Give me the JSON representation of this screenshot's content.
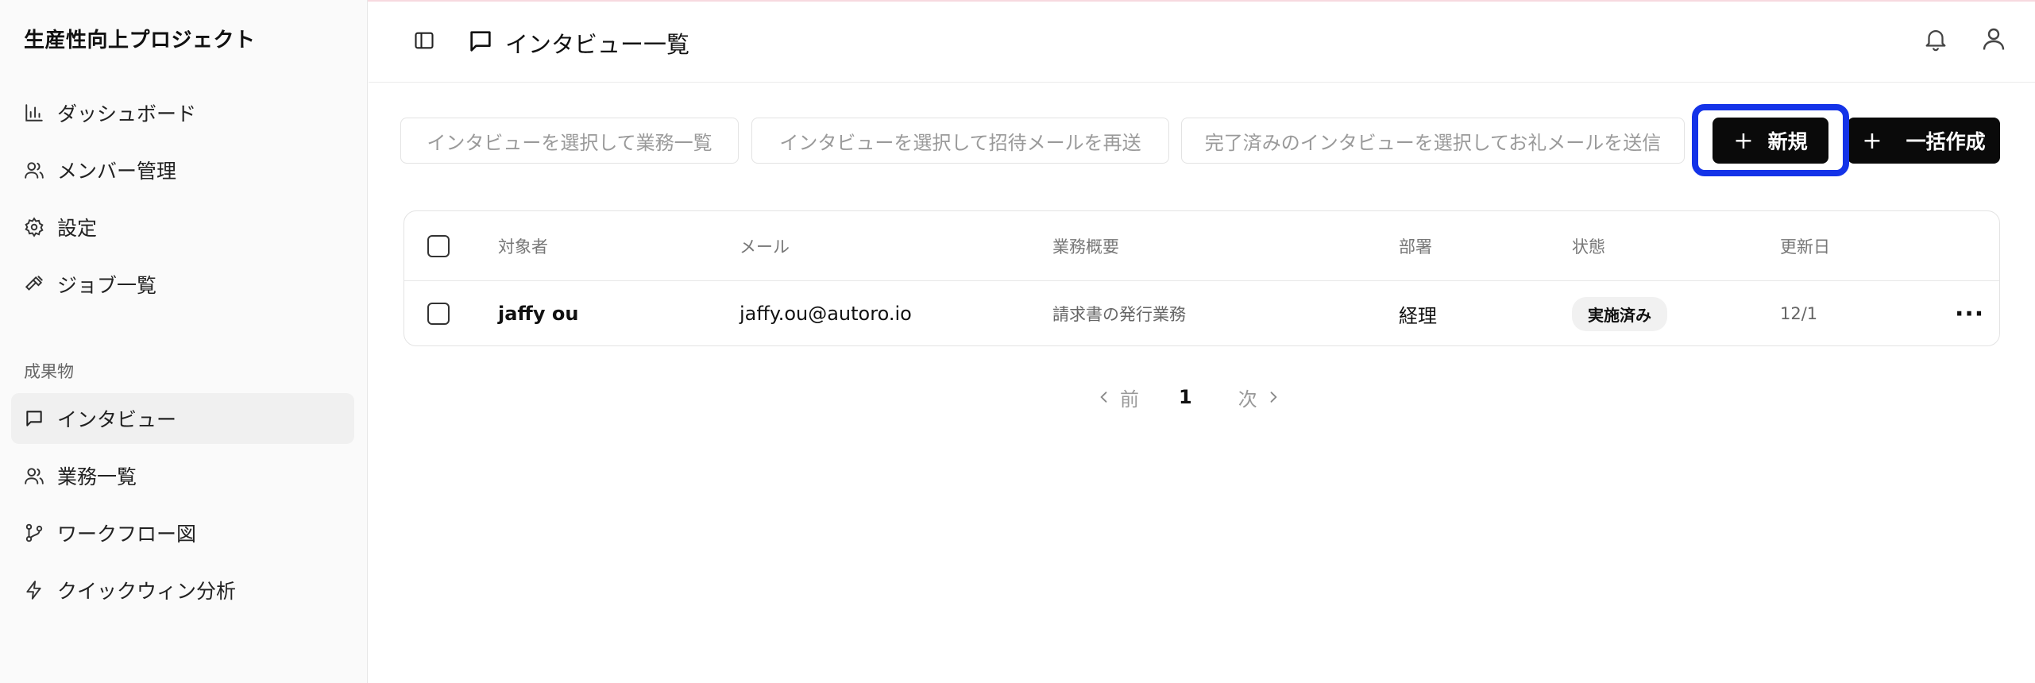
{
  "app": {
    "title": "生産性向上プロジェクト"
  },
  "sidebar": {
    "main_items": [
      {
        "label": "ダッシュボード",
        "icon": "bar-chart-icon"
      },
      {
        "label": "メンバー管理",
        "icon": "users-icon"
      },
      {
        "label": "設定",
        "icon": "gear-icon"
      },
      {
        "label": "ジョブ一覧",
        "icon": "hammer-icon"
      }
    ],
    "group_label": "成果物",
    "group_items": [
      {
        "label": "インタビュー",
        "icon": "message-square-icon",
        "active": true
      },
      {
        "label": "業務一覧",
        "icon": "users-icon"
      },
      {
        "label": "ワークフロー図",
        "icon": "git-branch-icon"
      },
      {
        "label": "クイックウィン分析",
        "icon": "zap-icon"
      }
    ]
  },
  "header": {
    "title": "インタビュー一覧"
  },
  "toolbar": {
    "btn_task_list": "インタビューを選択して業務一覧",
    "btn_resend_invite": "インタビューを選択して招待メールを再送",
    "btn_thank_you": "完了済みのインタビューを選択してお礼メールを送信",
    "btn_new": "新規",
    "btn_bulk_create": "一括作成",
    "plus_glyph": "+"
  },
  "table": {
    "columns": [
      "対象者",
      "メール",
      "業務概要",
      "部署",
      "状態",
      "更新日"
    ],
    "rows": [
      {
        "name": "jaffy ou",
        "email": "jaffy.ou@autoro.io",
        "summary": "請求書の発行業務",
        "department": "経理",
        "status": "実施済み",
        "updated": "12/1",
        "menu": "···"
      }
    ]
  },
  "pagination": {
    "prev": "前",
    "current": "1",
    "next": "次"
  },
  "colors": {
    "highlight": "#1433e8",
    "primary_button": "#0a0a0a"
  }
}
